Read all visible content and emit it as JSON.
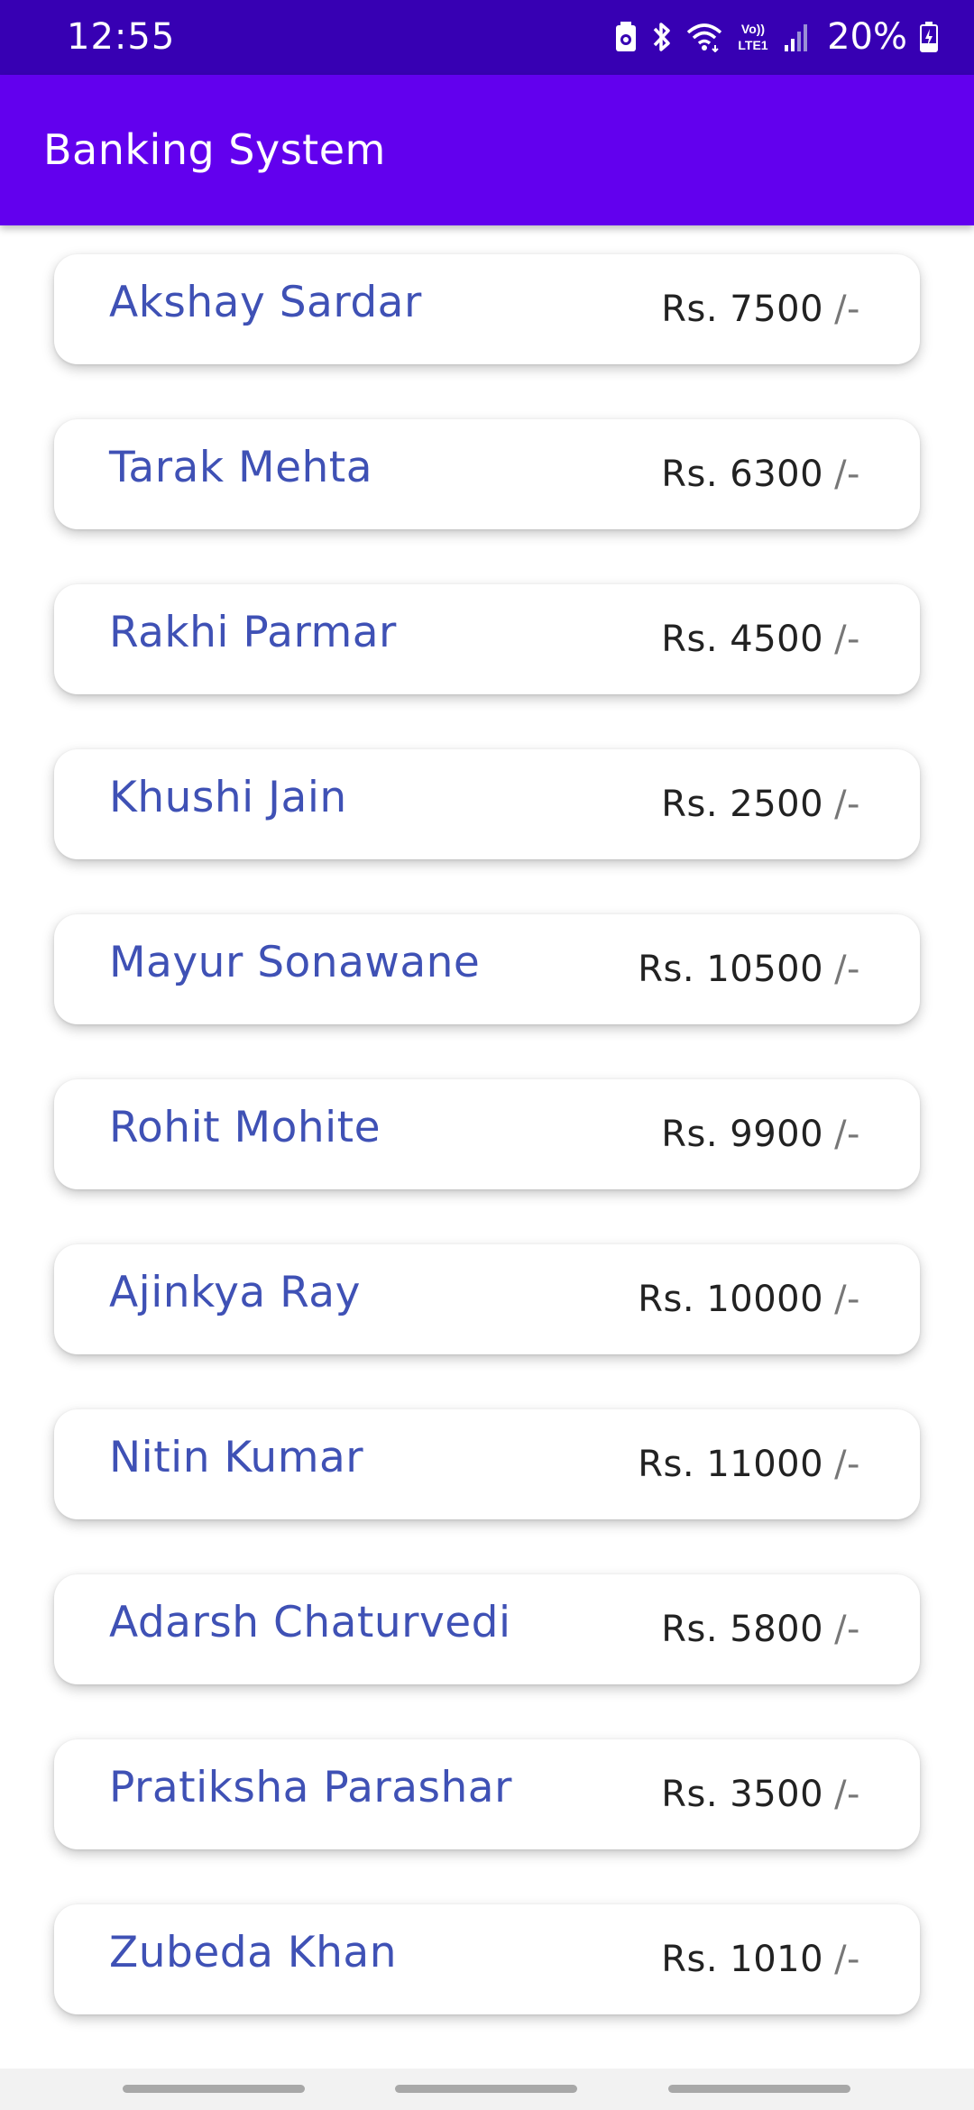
{
  "status_bar": {
    "time": "12:55",
    "volte_label": "Vo))",
    "lte_label": "LTE1",
    "battery_percent": "20%",
    "icons": [
      "battery-saver-icon",
      "bluetooth-icon",
      "wifi-icon",
      "volte-icon",
      "signal-icon",
      "battery-charging-icon"
    ]
  },
  "app_bar": {
    "title": "Banking System"
  },
  "customers": [
    {
      "name": "Akshay Sardar",
      "balance": "Rs. 7500",
      "suffix": "/-"
    },
    {
      "name": "Tarak Mehta",
      "balance": "Rs. 6300",
      "suffix": "/-"
    },
    {
      "name": "Rakhi Parmar",
      "balance": "Rs. 4500",
      "suffix": "/-"
    },
    {
      "name": "Khushi Jain",
      "balance": "Rs. 2500",
      "suffix": "/-"
    },
    {
      "name": "Mayur Sonawane",
      "balance": "Rs. 10500",
      "suffix": "/-"
    },
    {
      "name": "Rohit Mohite",
      "balance": "Rs. 9900",
      "suffix": "/-"
    },
    {
      "name": "Ajinkya Ray",
      "balance": "Rs. 10000",
      "suffix": "/-"
    },
    {
      "name": "Nitin Kumar",
      "balance": "Rs. 11000",
      "suffix": "/-"
    },
    {
      "name": "Adarsh Chaturvedi",
      "balance": "Rs. 5800",
      "suffix": "/-"
    },
    {
      "name": "Pratiksha Parashar",
      "balance": "Rs. 3500",
      "suffix": "/-"
    },
    {
      "name": "Zubeda Khan",
      "balance": "Rs. 1010",
      "suffix": "/-"
    }
  ],
  "colors": {
    "status_bar": "#3700b3",
    "app_bar": "#6200ee",
    "name_text": "#3f51b5"
  }
}
